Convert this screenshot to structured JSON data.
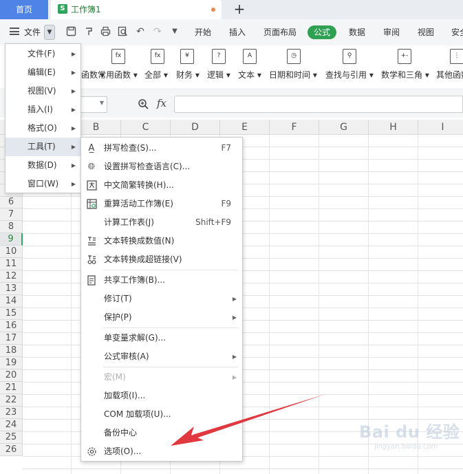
{
  "titlebar": {
    "home_tab": "首页",
    "workbook_tab": "工作簿1",
    "new_tab": "+"
  },
  "menubar": {
    "file_label": "文件",
    "tabs": [
      "开始",
      "插入",
      "页面布局",
      "公式",
      "数据",
      "审阅",
      "视图",
      "安全"
    ],
    "active_tab": "公式"
  },
  "ribbon": {
    "groups": [
      "函数",
      "常用函数",
      "全部",
      "财务",
      "逻辑",
      "文本",
      "日期和时间",
      "查找与引用",
      "数学和三角",
      "其他函数"
    ]
  },
  "formula_bar": {
    "fx_label": "fx"
  },
  "grid": {
    "columns": [
      "B",
      "C",
      "D",
      "E",
      "F",
      "G",
      "H",
      "I"
    ],
    "rows": [
      "6",
      "7",
      "8",
      "9",
      "10",
      "11",
      "12",
      "13",
      "14",
      "15",
      "16",
      "17",
      "18",
      "19",
      "20",
      "21",
      "22",
      "23",
      "24",
      "25",
      "26"
    ],
    "active_row": "9"
  },
  "main_menu": {
    "items": [
      {
        "label": "文件(F)",
        "has_submenu": true
      },
      {
        "label": "编辑(E)",
        "has_submenu": true
      },
      {
        "label": "视图(V)",
        "has_submenu": true
      },
      {
        "label": "插入(I)",
        "has_submenu": true
      },
      {
        "label": "格式(O)",
        "has_submenu": true
      },
      {
        "label": "工具(T)",
        "has_submenu": true
      },
      {
        "label": "数据(D)",
        "has_submenu": true
      },
      {
        "label": "窗口(W)",
        "has_submenu": true
      }
    ],
    "hovered": "工具(T)"
  },
  "tools_menu": {
    "items": [
      {
        "label": "拼写检查(S)...",
        "shortcut": "F7",
        "icon": "spellcheck-icon"
      },
      {
        "label": "设置拼写检查语言(C)...",
        "shortcut": "",
        "icon": "globe-icon"
      },
      {
        "label": "中文简繁转换(H)...",
        "shortcut": "",
        "icon": "text-convert-icon"
      },
      {
        "label": "重算活动工作簿(E)",
        "shortcut": "F9",
        "icon": "recalc-icon"
      },
      {
        "label": "计算工作表(J)",
        "shortcut": "Shift+F9",
        "icon": ""
      },
      {
        "label": "文本转换成数值(N)",
        "shortcut": "",
        "icon": "text-to-number-icon"
      },
      {
        "label": "文本转换成超链接(V)",
        "shortcut": "",
        "icon": "hyperlink-icon"
      },
      {
        "label": "共享工作簿(B)...",
        "shortcut": "",
        "icon": "share-icon"
      },
      {
        "label": "修订(T)",
        "shortcut": "",
        "icon": "",
        "has_submenu": true
      },
      {
        "label": "保护(P)",
        "shortcut": "",
        "icon": "",
        "has_submenu": true
      },
      {
        "label": "单变量求解(G)...",
        "shortcut": "",
        "icon": ""
      },
      {
        "label": "公式审核(A)",
        "shortcut": "",
        "icon": "",
        "has_submenu": true
      },
      {
        "label": "宏(M)",
        "shortcut": "",
        "icon": "",
        "has_submenu": true,
        "disabled": true
      },
      {
        "label": "加载项(I)...",
        "shortcut": "",
        "icon": ""
      },
      {
        "label": "COM 加载项(U)...",
        "shortcut": "",
        "icon": ""
      },
      {
        "label": "备份中心",
        "shortcut": "",
        "icon": ""
      },
      {
        "label": "选项(O)...",
        "shortcut": "",
        "icon": "gear-icon"
      }
    ]
  },
  "annotation": {
    "arrow_color": "#e0383e",
    "target": "选项(O)..."
  },
  "watermark": {
    "text": "Bai du 经验",
    "sub": "jingyan.baidu.com"
  },
  "colors": {
    "accent_green": "#30a152",
    "home_tab_blue": "#4f84e6"
  }
}
